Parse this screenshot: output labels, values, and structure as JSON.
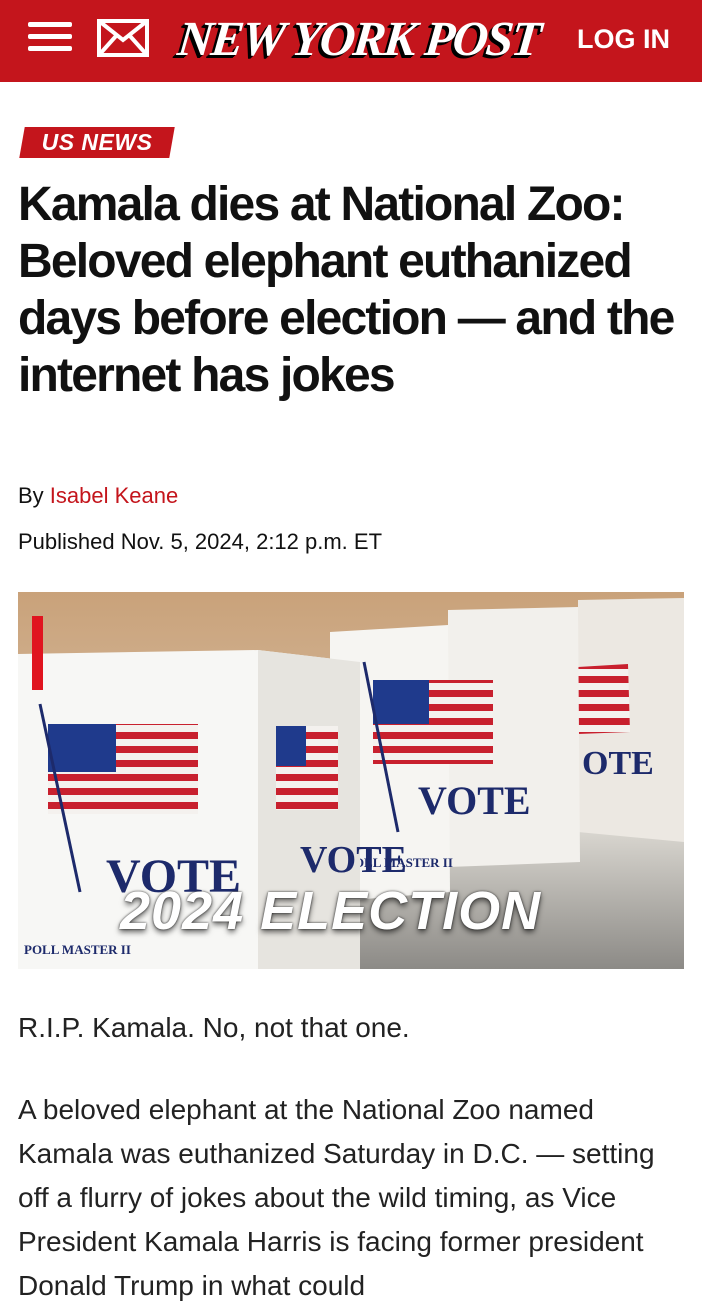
{
  "header": {
    "logo": "NEW YORK POST",
    "login_label": "LOG IN",
    "menu_icon": "hamburger-menu-icon",
    "mail_icon": "envelope-icon",
    "brand_color": "#c4151c"
  },
  "article": {
    "section": "US NEWS",
    "headline": "Kamala dies at National Zoo: Beloved elephant euthanized days before election — and the internet has jokes",
    "byline_prefix": "By ",
    "author": "Isabel Keane",
    "published": "Published Nov. 5, 2024, 2:12 p.m. ET",
    "video": {
      "overlay_text": "2024 ELECTION",
      "booth_word": "VOTE",
      "booth_brand": "POLL MASTER II"
    },
    "paragraphs": [
      "R.I.P. Kamala. No, not that one.",
      "A beloved elephant at the National Zoo named Kamala was euthanized Saturday in D.C. — setting off a flurry of jokes about the wild timing, as Vice President Kamala Harris is facing former president Donald Trump in what could"
    ]
  }
}
